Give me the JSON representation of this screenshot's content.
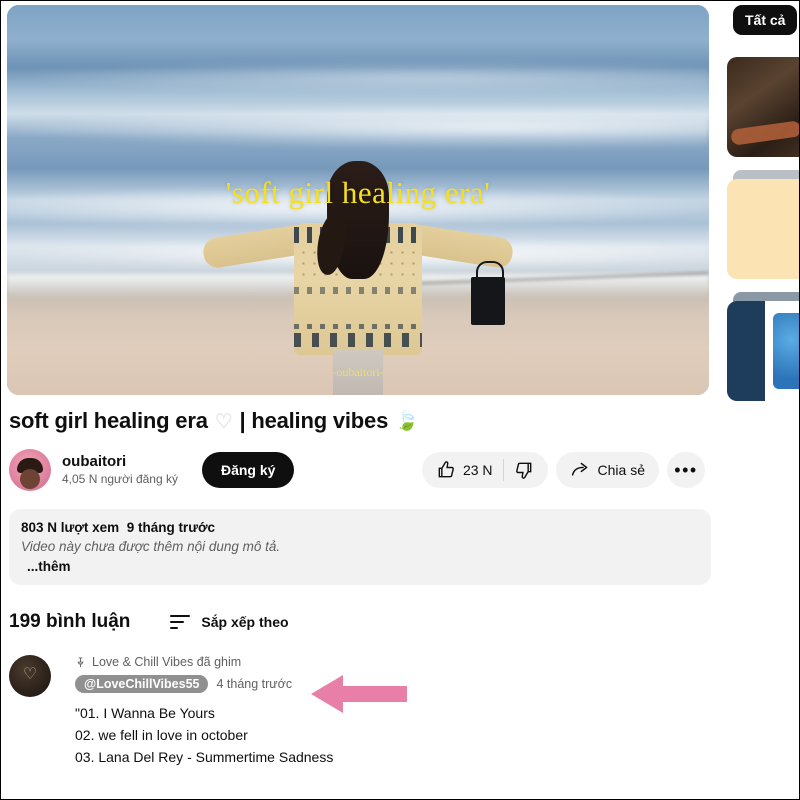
{
  "player": {
    "overlay_title": "'soft girl healing era'",
    "watermark": "-oubaitori-"
  },
  "video": {
    "title_text": "soft girl healing era",
    "title_heart": "♡",
    "title_divider": "| healing vibes",
    "title_leaf": "🍃"
  },
  "channel": {
    "name": "oubaitori",
    "subscribers": "4,05 N người đăng ký",
    "subscribe_label": "Đăng ký"
  },
  "actions": {
    "like_count": "23 N",
    "share_label": "Chia sẻ",
    "more_label": "•••"
  },
  "description": {
    "views": "803 N lượt xem",
    "published": "9 tháng trước",
    "body": "Video này chưa được thêm nội dung mô tả.",
    "more": "...thêm"
  },
  "comments": {
    "count_label": "199 bình luận",
    "sort_label": "Sắp xếp theo",
    "pinned": {
      "pin_note": "Love & Chill Vibes đã ghim",
      "author": "@LoveChillVibes55",
      "time": "4 tháng trước",
      "lines": [
        "\"01. I Wanna Be Yours",
        "02. we fell in love in october",
        "03. Lana Del Rey - Summertime Sadness"
      ]
    }
  },
  "sidebar": {
    "chip_label": "Tất cả"
  },
  "colors": {
    "accent_yellow": "#f5e020",
    "arrow_pink": "#e87fa8",
    "surface_grey": "#f2f2f2",
    "text_primary": "#0f0f0f",
    "text_secondary": "#606060"
  }
}
